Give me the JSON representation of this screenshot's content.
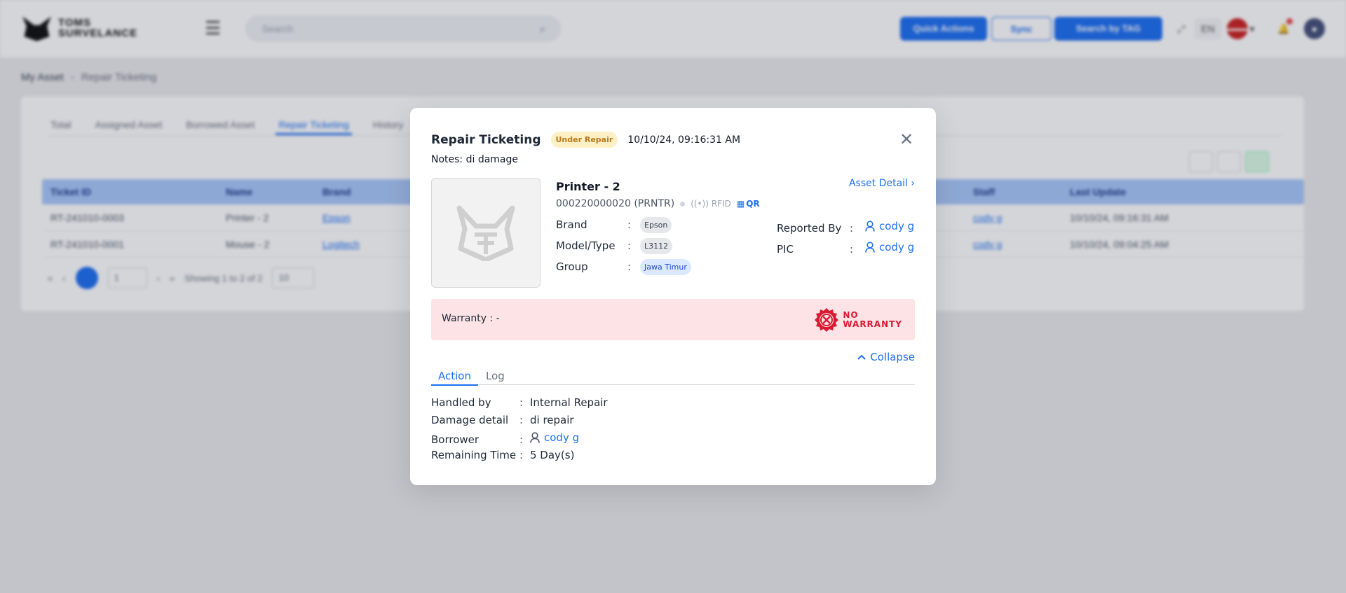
{
  "app": {
    "logo_text": "TOMS SURVELANCE",
    "search_placeholder": "Search",
    "buttons": {
      "quick_actions": "Quick Actions",
      "sync": "Sync",
      "search_by_tag": "Search by TAG"
    },
    "lang": "EN",
    "breadcrumb": {
      "root": "My Asset",
      "current": "Repair Ticketing"
    },
    "tabs": [
      "Total",
      "Assigned Asset",
      "Borrowed Asset",
      "Repair Ticketing",
      "History"
    ],
    "active_tab": "Repair Ticketing",
    "table": {
      "headers": [
        "Ticket ID",
        "Name",
        "Brand",
        "Staff",
        "Last Update"
      ],
      "rows": [
        [
          "RT-241010-0003",
          "Printer - 2",
          "Epson",
          "cody g",
          "10/10/24, 09:16:31 AM"
        ],
        [
          "RT-241010-0001",
          "Mouse - 2",
          "Logitech",
          "cody g",
          "10/10/24, 09:04:25 AM"
        ]
      ]
    },
    "pagination": {
      "page": "1",
      "showing": "Showing 1 to 2 of 2",
      "page_size": "10"
    }
  },
  "modal": {
    "title": "Repair Ticketing",
    "status": "Under Repair",
    "timestamp": "10/10/24, 09:16:31 AM",
    "notes": "Notes: di damage",
    "asset_name": "Printer - 2",
    "asset_code": "000220000020 (PRNTR)",
    "rfid_label": "RFID",
    "qr_label": "QR",
    "asset_detail_link": "Asset Detail",
    "brand_label": "Brand",
    "brand_value": "Epson",
    "model_label": "Model/Type",
    "model_value": "L3112",
    "group_label": "Group",
    "group_value": "Jawa Timur",
    "reported_by_label": "Reported By",
    "reported_by_value": "cody g",
    "pic_label": "PIC",
    "pic_value": "cody g",
    "warranty_text": "Warranty : -",
    "no_warranty_line1": "NO",
    "no_warranty_line2": "WARRANTY",
    "collapse_label": "Collapse",
    "tabs": {
      "action": "Action",
      "log": "Log"
    },
    "action": {
      "handled_by_label": "Handled by",
      "handled_by_value": "Internal Repair",
      "damage_label": "Damage detail",
      "damage_value": "di repair",
      "borrower_label": "Borrower",
      "borrower_value": "cody g",
      "remaining_label": "Remaining Time",
      "remaining_value": "5 Day(s)"
    },
    "colors": {
      "accent": "#1d6ff2",
      "warranty_bg": "#fde2e6",
      "no_warranty": "#d81b32",
      "status_bg": "#fdf0c4"
    }
  }
}
